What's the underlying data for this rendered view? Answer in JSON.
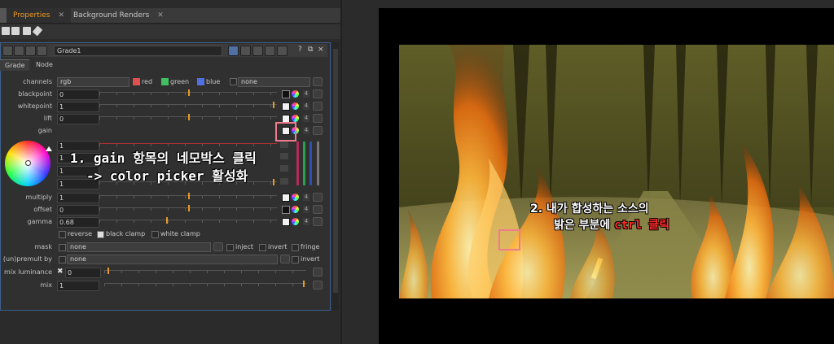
{
  "tabs": [
    {
      "label": "Properties",
      "active": true
    },
    {
      "label": "Background Renders",
      "active": false
    }
  ],
  "node": {
    "name": "Grade1",
    "tabs": [
      "Grade",
      "Node"
    ],
    "header_controls": [
      "?",
      "⧉",
      "×"
    ]
  },
  "channels": {
    "label": "channels",
    "value": "rgb",
    "red": "red",
    "green": "green",
    "blue": "blue",
    "extra": "none"
  },
  "params": [
    {
      "label": "blackpoint",
      "value": "0"
    },
    {
      "label": "whitepoint",
      "value": "1"
    },
    {
      "label": "lift",
      "value": "0"
    },
    {
      "label": "gain",
      "value": ""
    },
    {
      "label": "multiply",
      "value": "1"
    },
    {
      "label": "offset",
      "value": "0"
    },
    {
      "label": "gamma",
      "value": "0.68"
    }
  ],
  "gain_values": [
    "1",
    "1",
    "1",
    "1"
  ],
  "channel_count": "4",
  "slider_ticks": [
    "-0.1",
    "0",
    "0.1",
    "0.2",
    "0.3",
    "0.4",
    "0.5",
    "0.6",
    "0.7",
    "0.8",
    "0.9",
    "1"
  ],
  "clamp": {
    "reverse": "reverse",
    "black_clamp": "black clamp",
    "white_clamp": "white clamp"
  },
  "mask": {
    "label": "mask",
    "value": "none",
    "inject": "inject",
    "invert": "invert",
    "fringe": "fringe"
  },
  "premult": {
    "label": "(un)premult by",
    "value": "none",
    "invert": "invert"
  },
  "mix_luminance": {
    "label": "mix luminance",
    "value": "0"
  },
  "mix": {
    "label": "mix",
    "value": "1"
  },
  "annotations": {
    "step1_line1": "1. gain 항목의 네모박스 클릭",
    "step1_line2": "-> color picker 활성화",
    "step2_line1": "2. 내가 합성하는 소스의",
    "step2_line2a": "밝은 부분에 ",
    "step2_ctrl": "ctrl 클릭"
  },
  "colors": {
    "accent_orange": "#f39a1f",
    "panel_border": "#3d5f8c",
    "annotation_pink": "#ef7b8e",
    "ctrl_red": "#ff2a2a"
  }
}
